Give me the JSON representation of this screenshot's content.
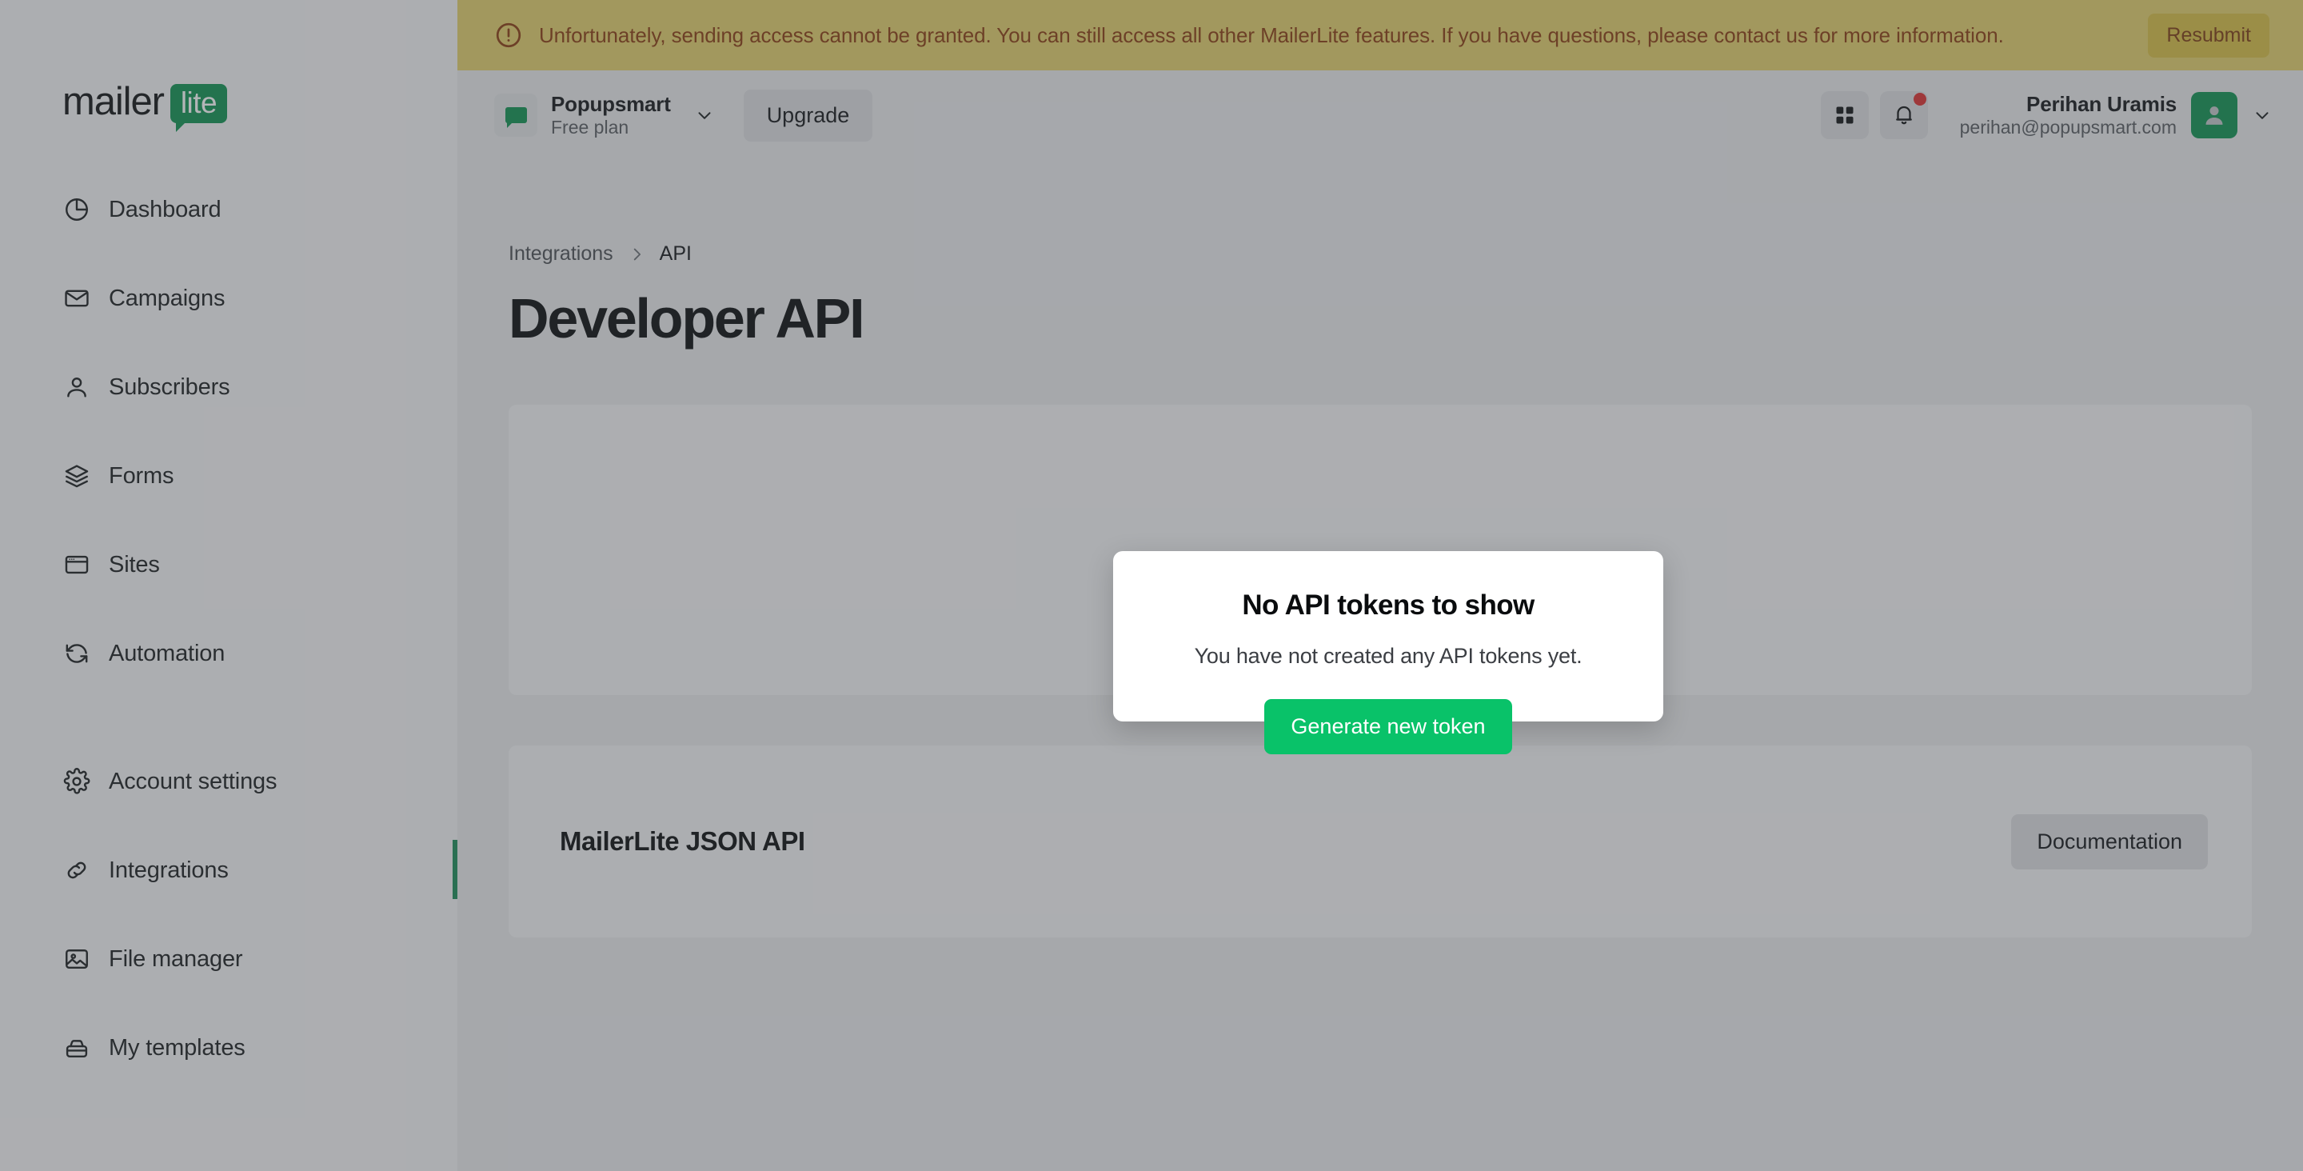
{
  "brand": {
    "logo_word": "mailer",
    "logo_badge": "lite",
    "green": "#0f9250",
    "accent_green": "#09c269",
    "active_indicator": "#1b8a58",
    "banner_bg": "#e3cf6c",
    "banner_text_color": "#8a3c10",
    "notification_dot": "#dc3030"
  },
  "banner": {
    "icon": "alert-circle-icon",
    "message": "Unfortunately, sending access cannot be granted. You can still access all other MailerLite features. If you have questions, please contact us for more information.",
    "action_label": "Resubmit"
  },
  "topbar": {
    "workspace": {
      "icon": "speech-bubble-icon",
      "name": "Popupsmart",
      "plan": "Free plan",
      "chevron": "chevron-down-icon"
    },
    "upgrade_label": "Upgrade",
    "apps_icon": "grid-icon",
    "notifications_icon": "bell-icon",
    "has_unread_notifications": true,
    "user": {
      "name": "Perihan Uramis",
      "email": "perihan@popupsmart.com",
      "avatar_icon": "user-avatar-icon",
      "chevron": "chevron-down-icon"
    }
  },
  "sidebar": {
    "primary": [
      {
        "label": "Dashboard",
        "icon": "pie-chart-icon",
        "active": false
      },
      {
        "label": "Campaigns",
        "icon": "envelope-icon",
        "active": false
      },
      {
        "label": "Subscribers",
        "icon": "person-icon",
        "active": false
      },
      {
        "label": "Forms",
        "icon": "layers-icon",
        "active": false
      },
      {
        "label": "Sites",
        "icon": "browser-icon",
        "active": false
      },
      {
        "label": "Automation",
        "icon": "refresh-icon",
        "active": false
      }
    ],
    "secondary": [
      {
        "label": "Account settings",
        "icon": "gear-icon",
        "active": false
      },
      {
        "label": "Integrations",
        "icon": "link-chain-icon",
        "active": true
      },
      {
        "label": "File manager",
        "icon": "image-icon",
        "active": false
      },
      {
        "label": "My templates",
        "icon": "briefcase-icon",
        "active": false
      }
    ]
  },
  "breadcrumb": {
    "parent": "Integrations",
    "separator": "chevron-right-icon",
    "current": "API"
  },
  "page": {
    "title": "Developer API"
  },
  "doc_panel": {
    "title": "MailerLite JSON API",
    "button_label": "Documentation"
  },
  "modal": {
    "title": "No API tokens to show",
    "subtitle": "You have not created any API tokens yet.",
    "primary_action": "Generate new token"
  }
}
